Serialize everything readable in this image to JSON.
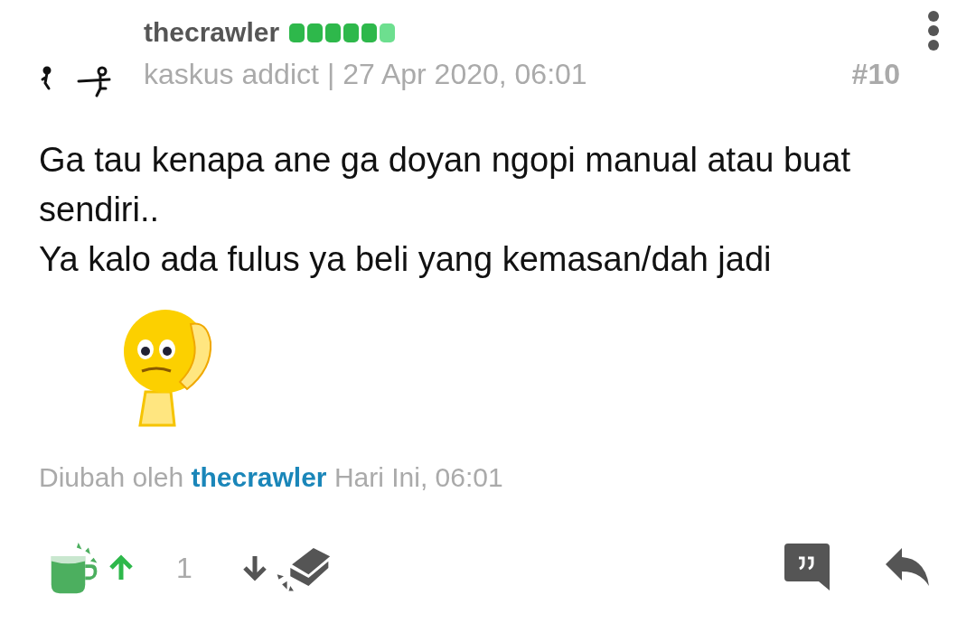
{
  "post": {
    "author": "thecrawler",
    "reputation": [
      {
        "color": "#2eb84b"
      },
      {
        "color": "#2eb84b"
      },
      {
        "color": "#2eb84b"
      },
      {
        "color": "#2eb84b"
      },
      {
        "color": "#2eb84b"
      },
      {
        "color": "#6ddf8f"
      }
    ],
    "rank": "kaskus addict",
    "separator": "|",
    "date": "27 Apr 2020, 06:01",
    "number": "#10"
  },
  "body_lines": [
    "Ga tau kenapa ane ga doyan ngopi manual atau buat sendiri..",
    "Ya kalo ada fulus ya beli yang kemasan/dah jadi"
  ],
  "edited": {
    "prefix": "Diubah oleh",
    "user": "thecrawler",
    "time": "Hari Ini, 06:01"
  },
  "votes": {
    "upvoted": true,
    "count": "1"
  }
}
